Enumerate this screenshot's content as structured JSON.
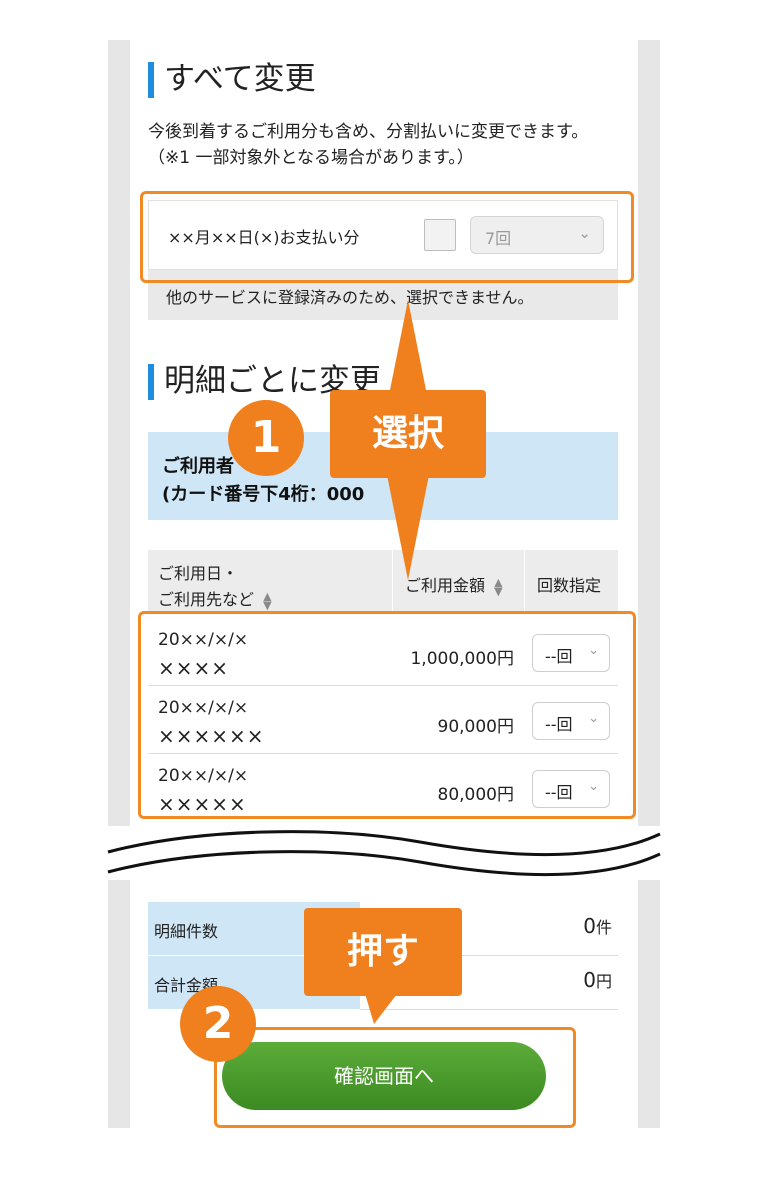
{
  "sections": {
    "all_change": {
      "title": "すべて変更",
      "note_line1": "今後到着するご利用分も含め、分割払いに変更できます。",
      "note_line2": "（※1 一部対象外となる場合があります。）",
      "payment_label": "××月××日(×)お支払い分",
      "installment_select": "7回",
      "disabled_message": "他のサービスに登録済みのため、選択できません。"
    },
    "per_item": {
      "title": "明細ごとに変更",
      "card_line1": "ご利用者",
      "card_line2": "(カード番号下4桁：000",
      "headers": {
        "date_line1": "ご利用日・",
        "date_line2": "ご利用先など",
        "amount": "ご利用金額",
        "count": "回数指定"
      },
      "rows": [
        {
          "date": "20××/×/×",
          "name": "××××",
          "amount": "1,000,000円",
          "select": "--回"
        },
        {
          "date": "20××/×/×",
          "name": "××××××",
          "amount": "90,000円",
          "select": "--回"
        },
        {
          "date": "20××/×/×",
          "name": "×××××",
          "amount": "80,000円",
          "select": "--回"
        }
      ]
    },
    "totals": {
      "count_label": "明細件数",
      "count_value": "0",
      "count_unit": "件",
      "sum_label": "合計金額",
      "sum_value": "0",
      "sum_unit": "円"
    },
    "confirm_button": "確認画面へ"
  },
  "annotations": {
    "step1_number": "1",
    "step1_label": "選択",
    "step2_number": "2",
    "step2_label": "押す"
  },
  "colors": {
    "accent_blue": "#1e8fe0",
    "callout_orange": "#f07f1d",
    "button_green": "#4a9a2e",
    "banner_blue": "#cfe6f6"
  }
}
